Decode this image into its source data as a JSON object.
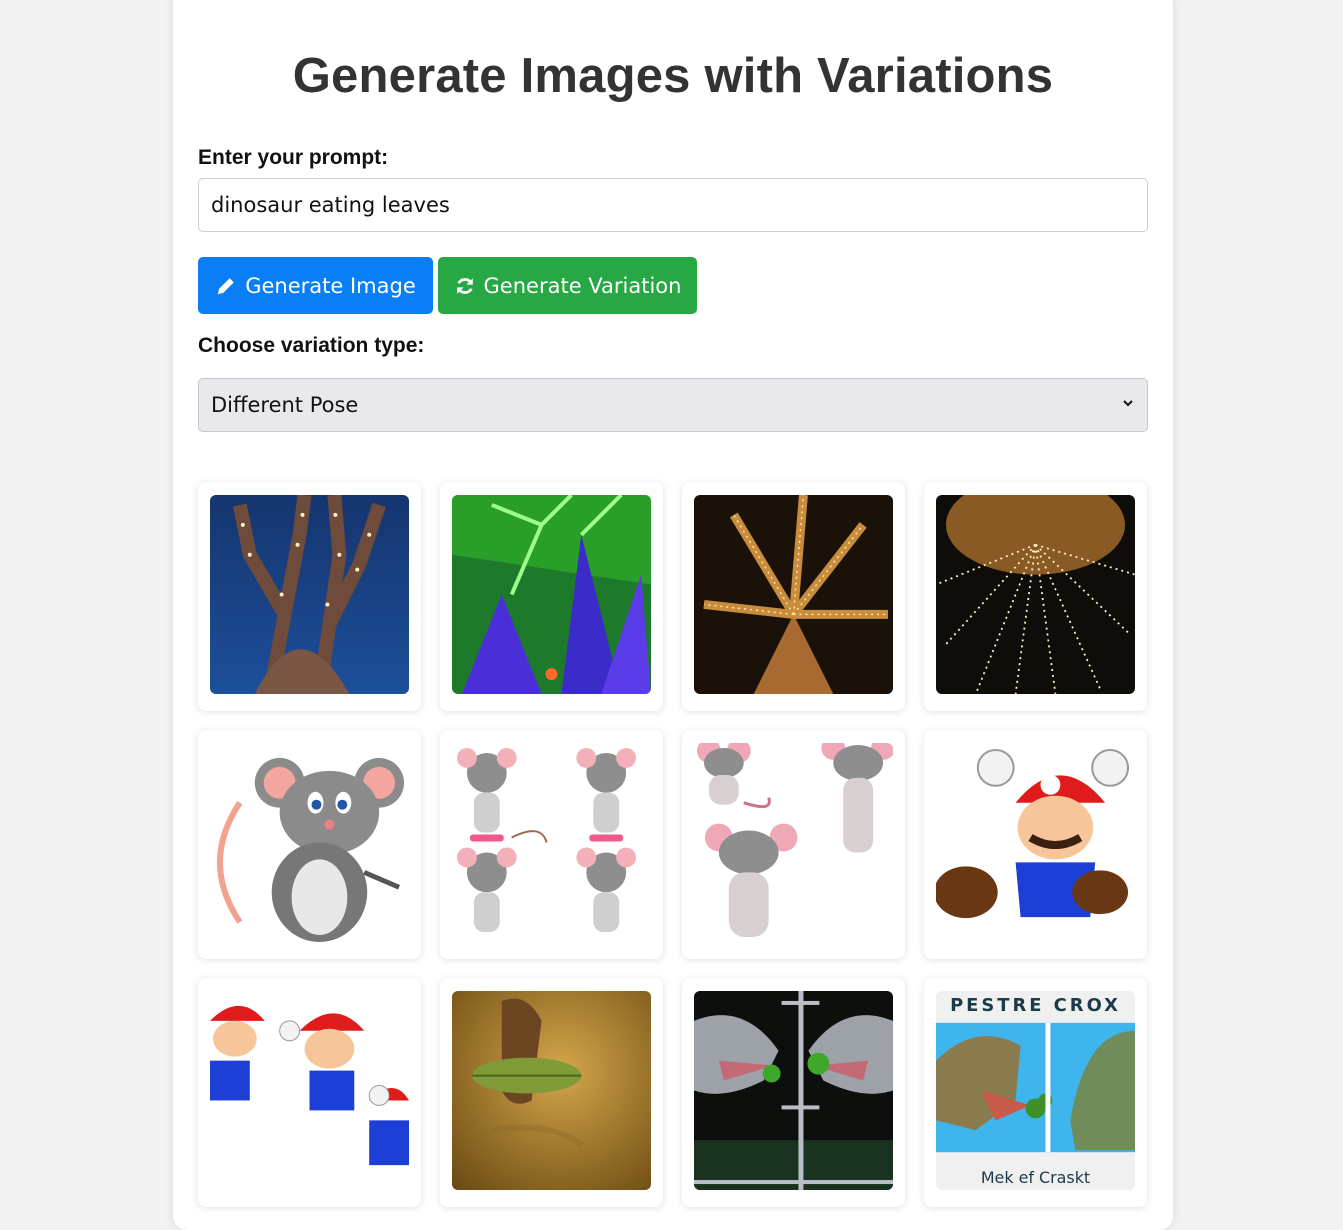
{
  "header": {
    "title": "Generate Images with Variations"
  },
  "prompt": {
    "label": "Enter your prompt:",
    "value": "dinosaur eating leaves"
  },
  "buttons": {
    "generate_image": "Generate Image",
    "generate_variation": "Generate Variation"
  },
  "variation": {
    "label": "Choose variation type:",
    "selected": "Different Pose"
  },
  "colors": {
    "primary": "#0a7ef5",
    "success": "#28a745"
  },
  "gallery": {
    "images": [
      {
        "subject": "lit tree at night, blue sky"
      },
      {
        "subject": "trees with blue and green lights"
      },
      {
        "subject": "tree canopy with warm lights"
      },
      {
        "subject": "tree from below with string lights"
      },
      {
        "subject": "cartoon mouse"
      },
      {
        "subject": "four cartoon mice"
      },
      {
        "subject": "cartoon mice in poses"
      },
      {
        "subject": "Mario jumping"
      },
      {
        "subject": "multiple Mario figures"
      },
      {
        "subject": "dinosaur toy with leaf"
      },
      {
        "subject": "two dinosaurs eating leaves"
      },
      {
        "subject": "dinosaur poster",
        "caption_top": "PESTRE CROX",
        "caption_bottom": "Mek ef Craskt"
      }
    ]
  }
}
